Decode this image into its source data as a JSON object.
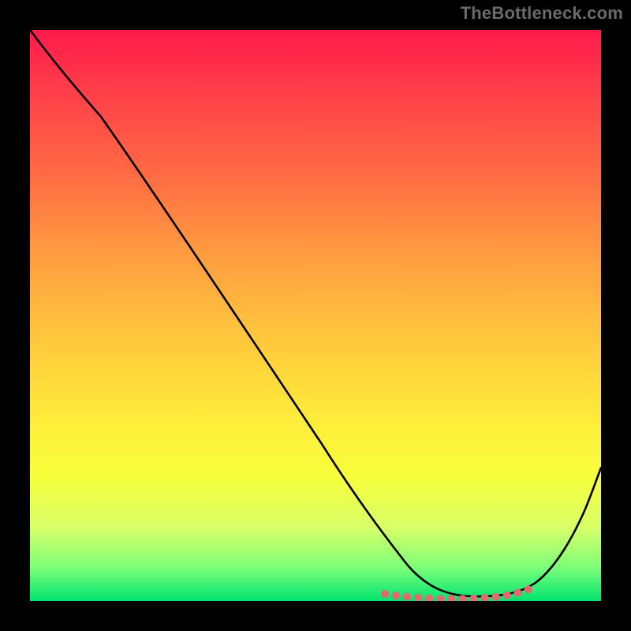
{
  "watermark": "TheBottleneck.com",
  "colors": {
    "frame_bg": "#000000",
    "gradient_top": "#ff1a4b",
    "gradient_bottom": "#00e46f",
    "curve": "#000000",
    "dotted_line": "#e26a6f"
  },
  "chart_data": {
    "type": "line",
    "title": "",
    "xlabel": "",
    "ylabel": "",
    "xlim": [
      0,
      100
    ],
    "ylim": [
      0,
      100
    ],
    "grid": false,
    "series": [
      {
        "name": "curve",
        "x": [
          0,
          6,
          14,
          22,
          30,
          38,
          46,
          54,
          58,
          62,
          66,
          70,
          74,
          78,
          82,
          86,
          90,
          94,
          100
        ],
        "y": [
          100,
          95,
          87,
          76,
          64,
          53,
          41,
          30,
          23,
          15,
          8,
          3,
          1,
          0,
          0,
          0,
          1,
          6,
          23
        ]
      }
    ],
    "annotations": [
      {
        "name": "flat-region-dots",
        "style": "dotted",
        "color": "#e26a6f",
        "x_range_pct": [
          62,
          88
        ],
        "y_value_pct": 0.7
      }
    ]
  }
}
